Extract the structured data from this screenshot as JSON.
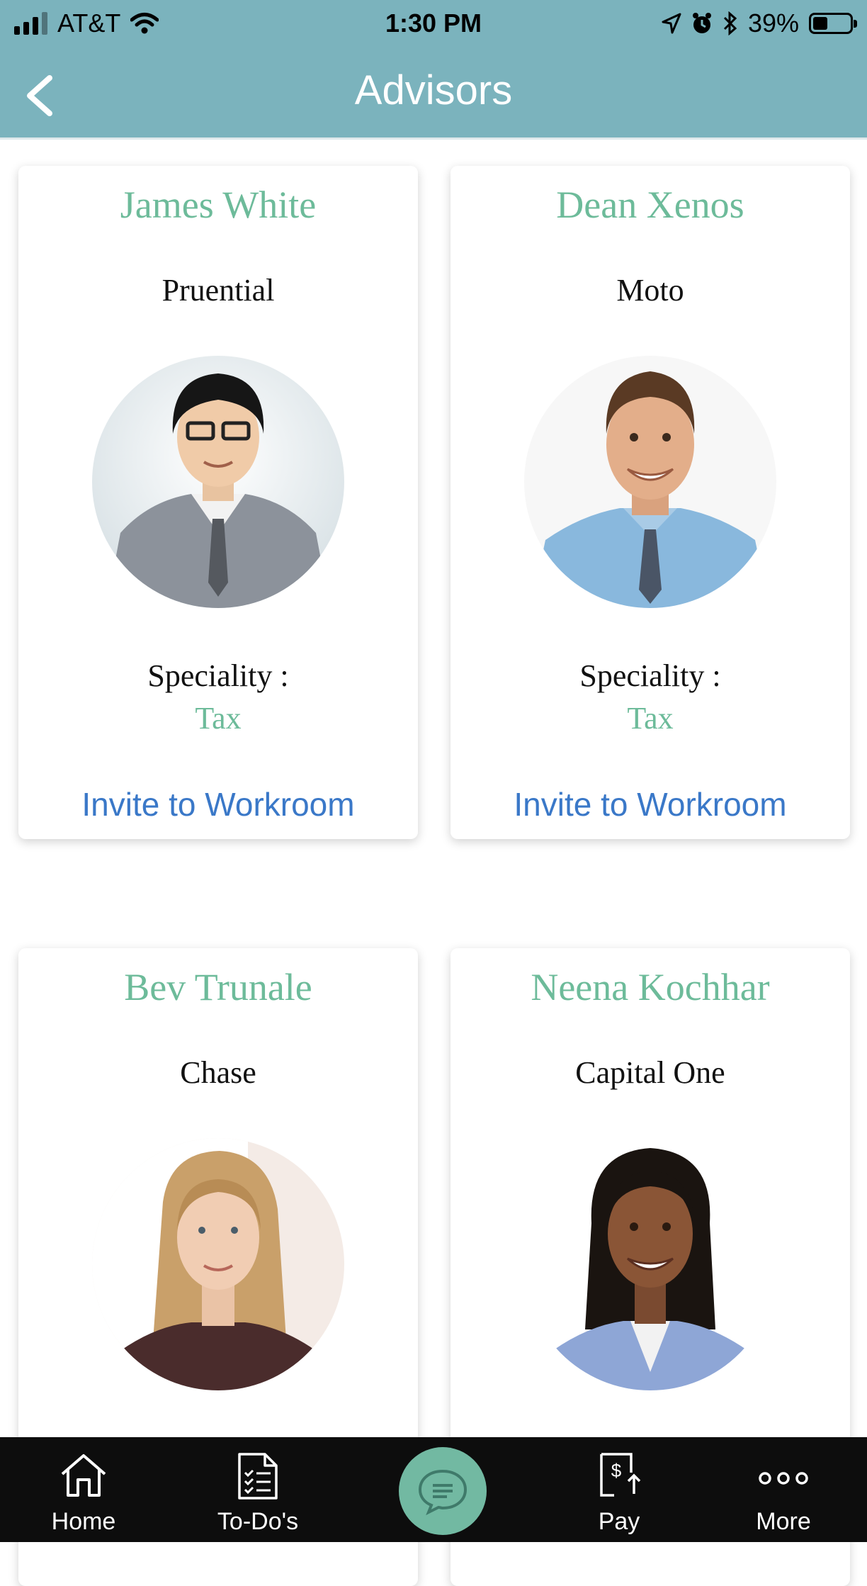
{
  "status_bar": {
    "carrier": "AT&T",
    "time": "1:30 PM",
    "battery": "39%",
    "battery_level": 0.39
  },
  "header": {
    "title": "Advisors",
    "back_icon": "chevron-left-icon"
  },
  "advisors": [
    {
      "name": "James White",
      "company": "Pruential",
      "speciality_label": "Speciality :",
      "speciality": "Tax",
      "invite_label": "Invite to Workroom"
    },
    {
      "name": "Dean Xenos",
      "company": "Moto",
      "speciality_label": "Speciality :",
      "speciality": "Tax",
      "invite_label": "Invite to Workroom"
    },
    {
      "name": "Bev Trunale",
      "company": "Chase"
    },
    {
      "name": "Neena Kochhar",
      "company": "Capital One"
    }
  ],
  "tabs": [
    {
      "label": "Home",
      "icon": "home-icon"
    },
    {
      "label": "To-Do's",
      "icon": "checklist-icon"
    },
    {
      "label": "",
      "icon": "chat-icon"
    },
    {
      "label": "Pay",
      "icon": "pay-icon"
    },
    {
      "label": "More",
      "icon": "more-icon"
    }
  ],
  "colors": {
    "header": "#7bb3bd",
    "name_green": "#6dbb9a",
    "link_blue": "#3a78c8",
    "tabbar": "#0d0d0d",
    "chat_button": "#72b9a2"
  }
}
